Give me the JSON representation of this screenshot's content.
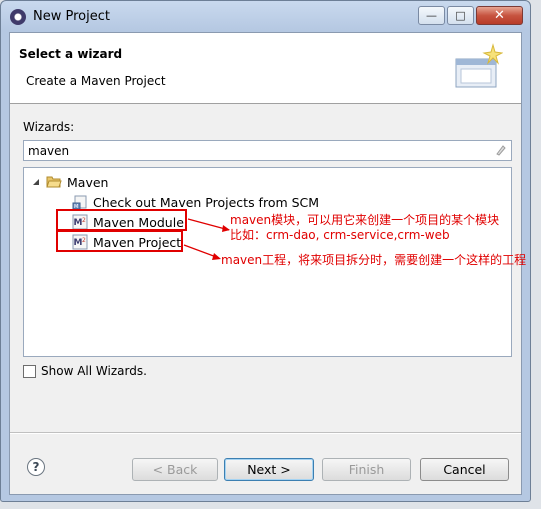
{
  "window": {
    "title": "New Project"
  },
  "header": {
    "title": "Select a wizard",
    "description": "Create a Maven Project"
  },
  "wizards": {
    "label": "Wizards:",
    "filter_value": "maven",
    "tree": {
      "category": "Maven",
      "items": [
        "Check out Maven Projects from SCM",
        "Maven Module",
        "Maven Project"
      ]
    }
  },
  "annotations": {
    "module_line1": "maven模块，可以用它来创建一个项目的某个模块",
    "module_line2": "比如：crm-dao,   crm-service,crm-web",
    "project": "maven工程，将来项目拆分时，需要创建一个这样的工程",
    "color": "#e00000"
  },
  "show_all": {
    "label": "Show All Wizards.",
    "checked": false
  },
  "buttons": {
    "help": "?",
    "back": "< Back",
    "next": "Next >",
    "finish": "Finish",
    "cancel": "Cancel"
  }
}
